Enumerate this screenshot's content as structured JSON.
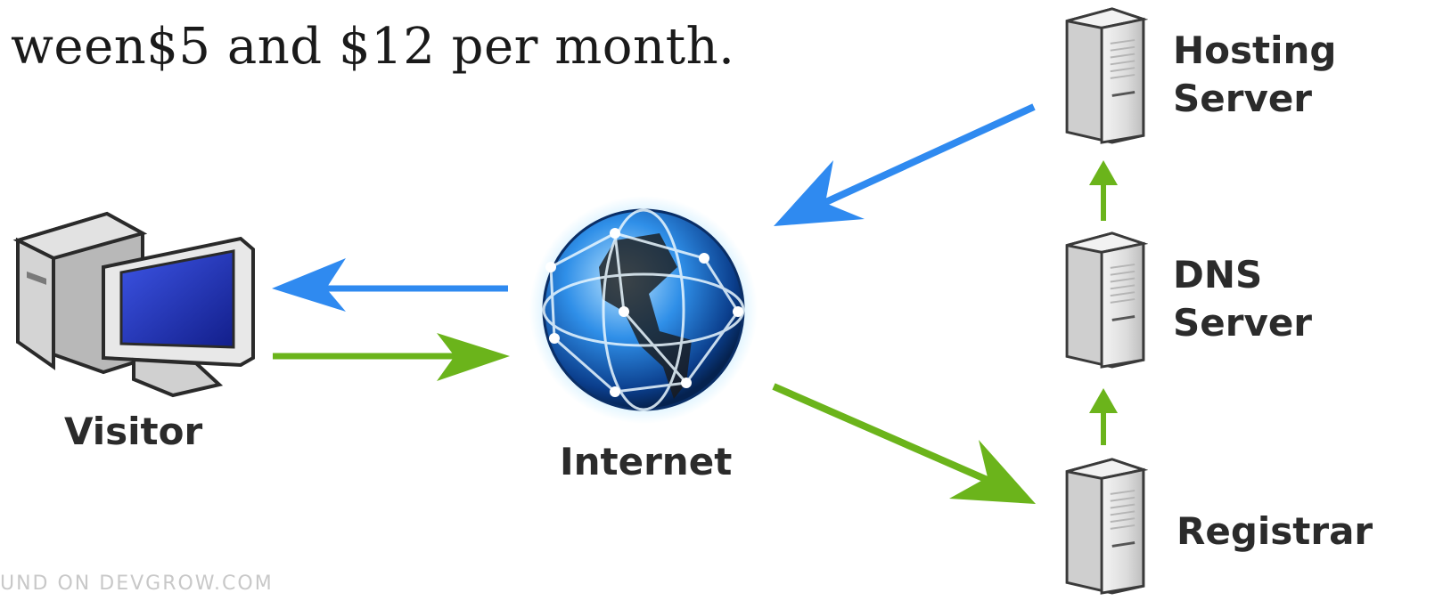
{
  "heading": "ween$5 and $12 per month.",
  "nodes": {
    "visitor": {
      "label": "Visitor"
    },
    "internet": {
      "label": "Internet"
    },
    "hosting_server": {
      "line1": "Hosting",
      "line2": "Server"
    },
    "dns_server": {
      "line1": "DNS",
      "line2": "Server"
    },
    "registrar": {
      "label": "Registrar"
    }
  },
  "watermark": "UND ON DEVGROW.COM",
  "colors": {
    "request_arrow": "#6bb41b",
    "response_arrow": "#2f8af0",
    "globe": "#1f6fd6",
    "server_body": "#e6e6e6",
    "monitor_screen": "#1f2fb8"
  },
  "edges": [
    {
      "from": "visitor",
      "to": "internet",
      "color": "green"
    },
    {
      "from": "internet",
      "to": "visitor",
      "color": "blue"
    },
    {
      "from": "internet",
      "to": "registrar",
      "color": "green"
    },
    {
      "from": "registrar",
      "to": "dns_server",
      "color": "green"
    },
    {
      "from": "dns_server",
      "to": "hosting_server",
      "color": "green"
    },
    {
      "from": "hosting_server",
      "to": "internet",
      "color": "blue"
    }
  ]
}
